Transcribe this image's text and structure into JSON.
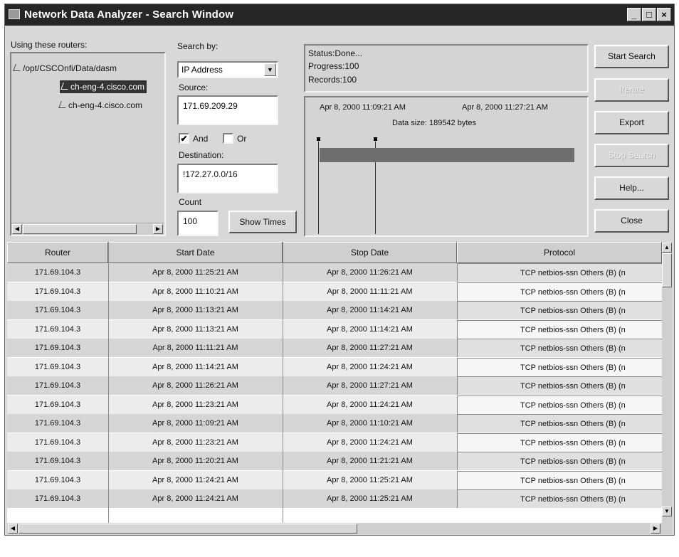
{
  "window": {
    "title": "Network Data Analyzer - Search Window",
    "controls": {
      "minimize": "_",
      "maximize": "□",
      "close": "×"
    }
  },
  "routers": {
    "label": "Using these routers:",
    "tree": [
      {
        "text": "/opt/CSCOnfi/Data/dasm",
        "level": 0,
        "selected": false
      },
      {
        "text": "ch-eng-4.cisco.com",
        "level": 1,
        "selected": true
      },
      {
        "text": "ch-eng-4.cisco.com",
        "level": 1,
        "selected": false
      }
    ]
  },
  "search": {
    "search_by_label": "Search by:",
    "search_by_value": "IP Address",
    "source_label": "Source:",
    "source_value": "171.69.209.29",
    "and_label": "And",
    "and_checked": true,
    "and_mark": "✔",
    "or_label": "Or",
    "or_checked": false,
    "destination_label": "Destination:",
    "destination_value": "!172.27.0.0/16",
    "count_label": "Count",
    "count_value": "100",
    "show_times_label": "Show Times"
  },
  "status": {
    "line1": "Status:Done...",
    "line2": "Progress:100",
    "line3": "Records:100"
  },
  "timeline": {
    "start": "Apr 8, 2000 11:09:21 AM",
    "end": "Apr 8, 2000 11:27:21 AM",
    "data_size": "Data size: 189542 bytes"
  },
  "buttons": {
    "start_search": "Start Search",
    "disabled1": "Iterate",
    "export": "Export",
    "stop_search": "Stop Search",
    "help": "Help...",
    "close": "Close"
  },
  "table": {
    "columns": [
      "Router",
      "Start Date",
      "Stop Date",
      "Protocol"
    ],
    "rows": [
      [
        "171.69.104.3",
        "Apr 8, 2000 11:25:21 AM",
        "Apr 8, 2000 11:26:21 AM",
        "TCP netbios-ssn Others (B) (n"
      ],
      [
        "171.69.104.3",
        "Apr 8, 2000 11:10:21 AM",
        "Apr 8, 2000 11:11:21 AM",
        "TCP netbios-ssn Others (B) (n"
      ],
      [
        "171.69.104.3",
        "Apr 8, 2000 11:13:21 AM",
        "Apr 8, 2000 11:14:21 AM",
        "TCP netbios-ssn Others (B) (n"
      ],
      [
        "171.69.104.3",
        "Apr 8, 2000 11:13:21 AM",
        "Apr 8, 2000 11:14:21 AM",
        "TCP netbios-ssn Others (B) (n"
      ],
      [
        "171.69.104.3",
        "Apr 8, 2000 11:11:21 AM",
        "Apr 8, 2000 11:27:21 AM",
        "TCP netbios-ssn Others (B) (n"
      ],
      [
        "171.69.104.3",
        "Apr 8, 2000 11:14:21 AM",
        "Apr 8, 2000 11:24:21 AM",
        "TCP netbios-ssn Others (B) (n"
      ],
      [
        "171.69.104.3",
        "Apr 8, 2000 11:26:21 AM",
        "Apr 8, 2000 11:27:21 AM",
        "TCP netbios-ssn Others (B) (n"
      ],
      [
        "171.69.104.3",
        "Apr 8, 2000 11:23:21 AM",
        "Apr 8, 2000 11:24:21 AM",
        "TCP netbios-ssn Others (B) (n"
      ],
      [
        "171.69.104.3",
        "Apr 8, 2000 11:09:21 AM",
        "Apr 8, 2000 11:10:21 AM",
        "TCP netbios-ssn Others (B) (n"
      ],
      [
        "171.69.104.3",
        "Apr 8, 2000 11:23:21 AM",
        "Apr 8, 2000 11:24:21 AM",
        "TCP netbios-ssn Others (B) (n"
      ],
      [
        "171.69.104.3",
        "Apr 8, 2000 11:20:21 AM",
        "Apr 8, 2000 11:21:21 AM",
        "TCP netbios-ssn Others (B) (n"
      ],
      [
        "171.69.104.3",
        "Apr 8, 2000 11:24:21 AM",
        "Apr 8, 2000 11:25:21 AM",
        "TCP netbios-ssn Others (B) (n"
      ],
      [
        "171.69.104.3",
        "Apr 8, 2000 11:24:21 AM",
        "Apr 8, 2000 11:25:21 AM",
        "TCP netbios-ssn Others (B) (n"
      ]
    ]
  },
  "icons": {
    "app": "network-app-icon",
    "dropdown": "chevron-down-icon",
    "scroll_left": "arrow-left-icon",
    "scroll_right": "arrow-right-icon",
    "scroll_up": "arrow-up-icon",
    "scroll_down": "arrow-down-icon",
    "tree_node": "router-node-icon"
  },
  "glyphs": {
    "dropdown": "▼",
    "left": "◀",
    "right": "▶",
    "up": "▲",
    "down": "▼"
  },
  "colors": {
    "titlebar": "#262626",
    "selection": "#333333",
    "timeline_bar": "#6e6e6e"
  }
}
